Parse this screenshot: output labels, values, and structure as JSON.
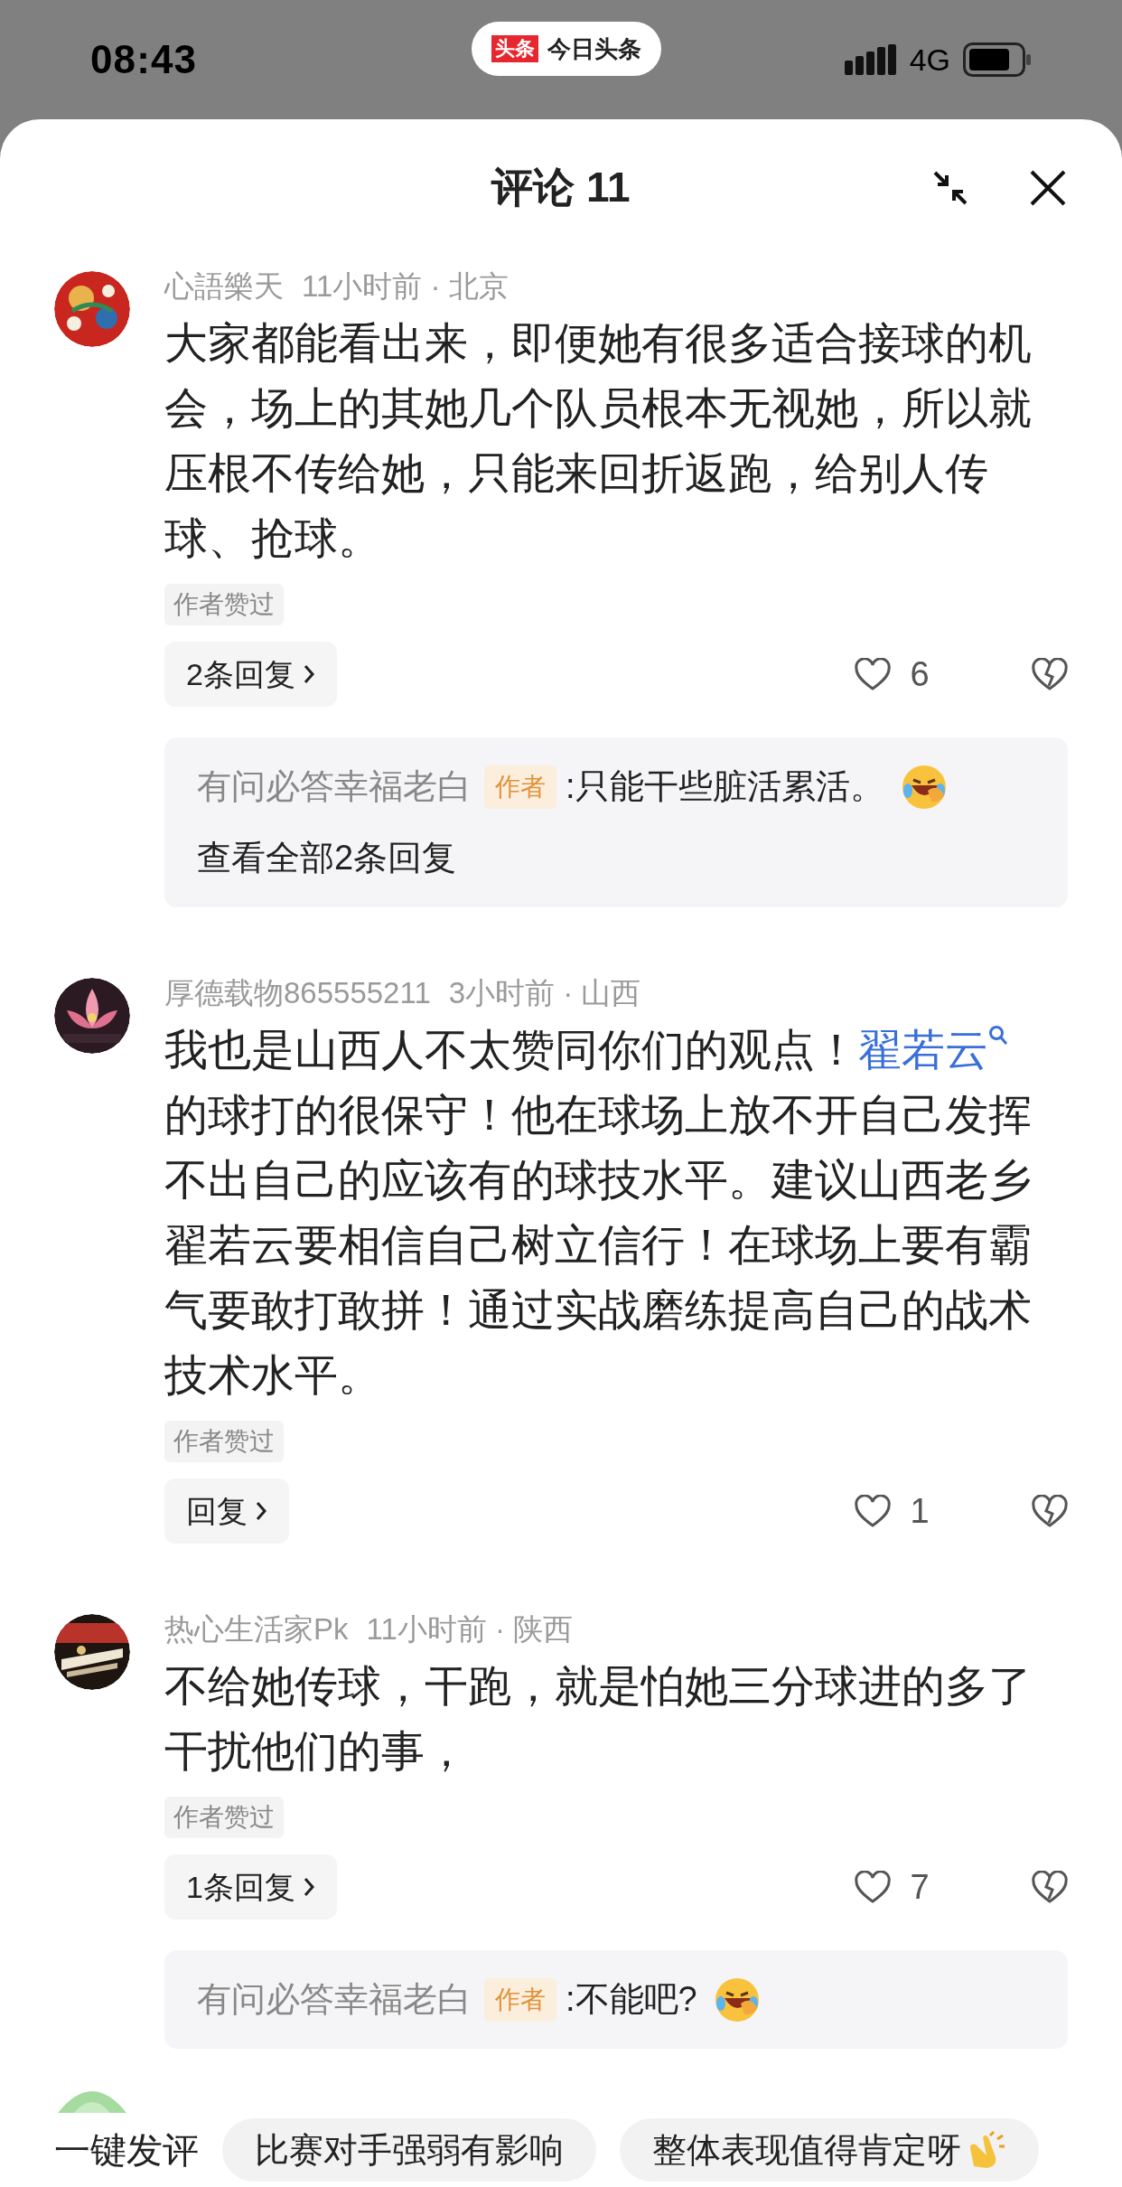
{
  "status_bar": {
    "time": "08:43",
    "app_logo": "头条",
    "app_name": "今日头条",
    "network": "4G"
  },
  "header": {
    "title": "评论 11"
  },
  "comments": [
    {
      "avatar": {
        "kind": "picture"
      },
      "user": "心語樂天",
      "meta": "11小时前 · 北京",
      "body": [
        {
          "kind": "text",
          "text": "大家都能看出来，即便她有很多适合接球的机会，场上的其她几个队员根本无视她，所以就压根不传给她，只能来回折返跑，给别人传球、抢球。"
        }
      ],
      "tag": "作者赞过",
      "reply_button": "2条回复",
      "likes": "6",
      "replies": [
        {
          "user": "有问必答幸福老白",
          "badge": "作者",
          "text": ":只能干些脏活累活。",
          "emoji": true
        }
      ],
      "view_all": "查看全部2条回复"
    },
    {
      "avatar": {
        "kind": "picture"
      },
      "user": "厚德载物865555211",
      "meta": "3小时前 · 山西",
      "body": [
        {
          "kind": "text",
          "text": "我也是山西人不太赞同你们的观点！"
        },
        {
          "kind": "link",
          "text": "翟若云"
        },
        {
          "kind": "text",
          "text": "的球打的很保守！他在球场上放不开自己发挥不出自己的应该有的球技水平。建议山西老乡翟若云要相信自己树立信行！在球场上要有霸气要敢打敢拼！通过实战磨练提高自己的战术技术水平。"
        }
      ],
      "tag": "作者赞过",
      "reply_button": "回复",
      "likes": "1"
    },
    {
      "avatar": {
        "kind": "picture"
      },
      "user": "热心生活家Pk",
      "meta": "11小时前 · 陕西",
      "body": [
        {
          "kind": "text",
          "text": "不给她传球，干跑，就是怕她三分球进的多了干扰他们的事，"
        }
      ],
      "tag": "作者赞过",
      "reply_button": "1条回复",
      "likes": "7",
      "replies": [
        {
          "user": "有问必答幸福老白",
          "badge": "作者",
          "text": ":不能吧?",
          "emoji": true
        }
      ]
    }
  ],
  "quick_comment": {
    "label": "一键发评",
    "suggestions": [
      {
        "text": "比赛对手强弱有影响",
        "emoji": false
      },
      {
        "text": "整体表现值得肯定呀",
        "emoji": true
      }
    ]
  }
}
